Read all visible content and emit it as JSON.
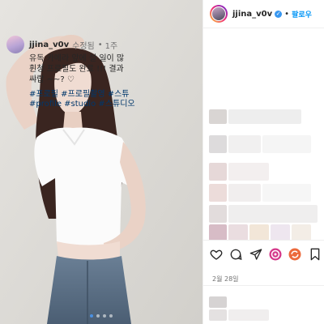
{
  "header": {
    "username": "jjina_v0v",
    "verified_icon": "✓",
    "separator": "•",
    "follow_label": "팔로우"
  },
  "caption": {
    "username": "jjina_v0v",
    "edited_label": "수정됨",
    "separator": "•",
    "time": "1주",
    "lines": [
      "유독 카메라 앞에 설 일이 많",
      "휜청 프로필도 완료 !!! 결과",
      "쌰랍 ~~? ♡"
    ],
    "hashtag_lines": [
      "#프로필 #프로필촬영 #스튜",
      "#profile #studio #스튜디오"
    ]
  },
  "post": {
    "date": "2월 28일"
  },
  "carousel": {
    "count": 4,
    "active": 1
  },
  "colors": {
    "link_blue": "#0095f6",
    "hashtag": "#00376b",
    "verified": "#3897f0",
    "active_dot": "#4a90e2"
  },
  "icons": [
    "heart-icon",
    "comment-icon",
    "share-icon",
    "reels-icon",
    "remix-icon",
    "bookmark-icon"
  ]
}
